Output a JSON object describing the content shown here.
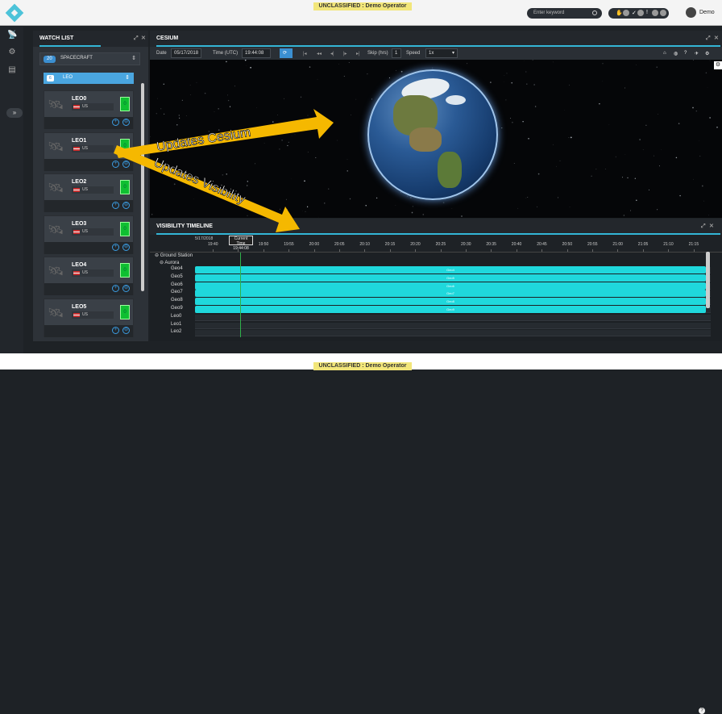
{
  "classification": "UNCLASSIFIED : Demo Operator",
  "header": {
    "search_placeholder": "Enter keyword",
    "user_name": "Demo"
  },
  "watchlist": {
    "title": "WATCH LIST",
    "spacecraft_count": "20",
    "spacecraft_label": "SPACECRAFT",
    "leo_count": "6",
    "leo_label": "LEO",
    "satellites": [
      {
        "name": "LEO0",
        "country": "US",
        "signal": "0"
      },
      {
        "name": "LEO1",
        "country": "US",
        "signal": "0"
      },
      {
        "name": "LEO2",
        "country": "US",
        "signal": "0"
      },
      {
        "name": "LEO3",
        "country": "US",
        "signal": "0"
      },
      {
        "name": "LEO4",
        "country": "US",
        "signal": "0"
      },
      {
        "name": "LEO5",
        "country": "US",
        "signal": "0"
      }
    ]
  },
  "cesium": {
    "title": "CESIUM",
    "date_label": "Date",
    "date_value": "05/17/2018",
    "time_label": "Time (UTC)",
    "time_value": "19:44:08",
    "skip_label": "Skip (hrs)",
    "skip_value": "1",
    "speed_label": "Speed",
    "speed_value": "1x"
  },
  "timeline": {
    "title": "VISIBILITY TIMELINE",
    "date": "5/17/2018",
    "current_time_label": "Current Time",
    "current_time": "19:44:08",
    "ticks": [
      "19:40",
      "19:45",
      "19:50",
      "19:55",
      "20:00",
      "20:05",
      "20:10",
      "20:15",
      "20:20",
      "20:25",
      "20:30",
      "20:35",
      "20:40",
      "20:45",
      "20:50",
      "20:55",
      "21:00",
      "21:05",
      "21:10",
      "21:15"
    ],
    "group": "Ground Station",
    "subgroup": "Aurora",
    "rows": [
      {
        "label": "Geo4",
        "bar": "Geo4"
      },
      {
        "label": "Geo5",
        "bar": "Geo5"
      },
      {
        "label": "Geo6",
        "bar": "Geo6"
      },
      {
        "label": "Geo7",
        "bar": "Geo7"
      },
      {
        "label": "Geo8",
        "bar": "Geo8"
      },
      {
        "label": "Geo9",
        "bar": "Geo9"
      },
      {
        "label": "Leo0",
        "bar": ""
      },
      {
        "label": "Leo1",
        "bar": ""
      },
      {
        "label": "Leo2",
        "bar": ""
      }
    ]
  },
  "annotations": {
    "updates_cesium": "Updates Cesium",
    "updates_visibility": "Updates Visibility",
    "arrow_color": "#f5b800"
  }
}
